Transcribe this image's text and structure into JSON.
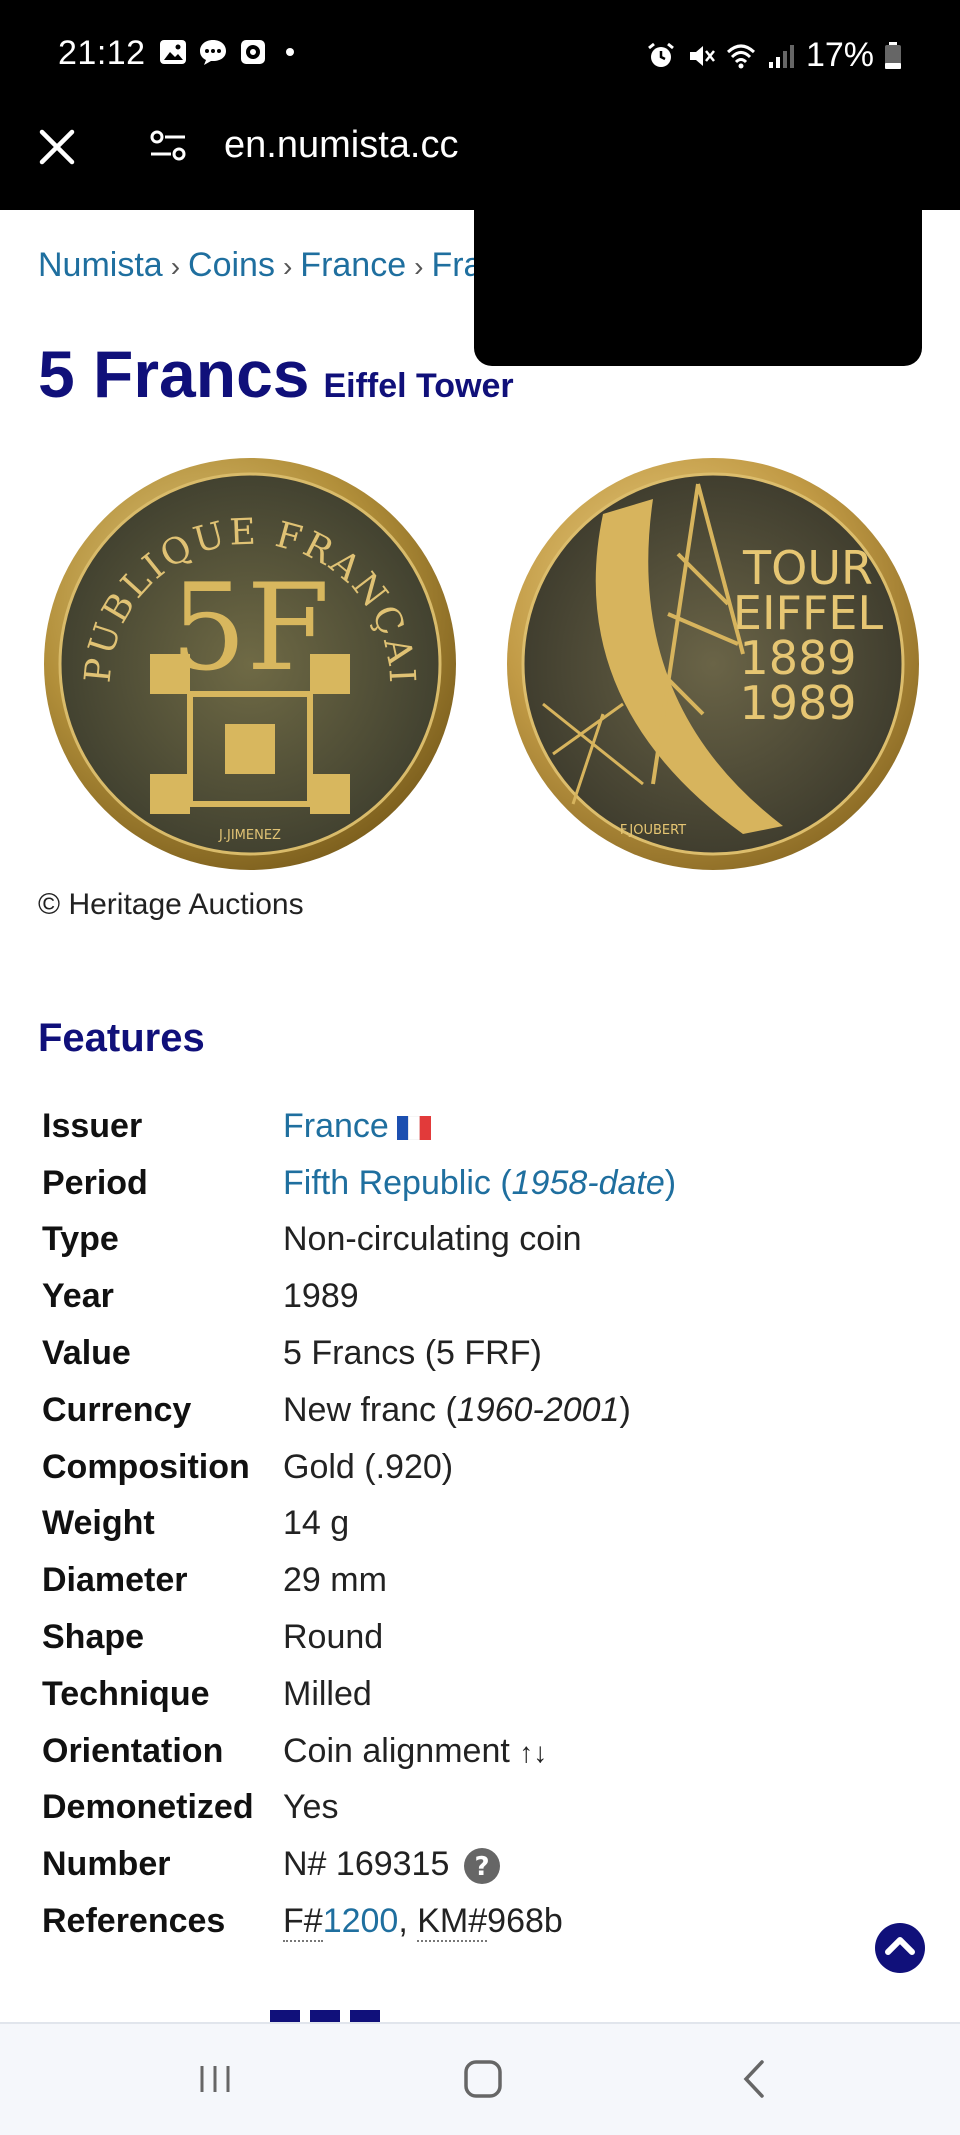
{
  "status_bar": {
    "time": "21:12",
    "battery": "17%",
    "left_icons": [
      "gallery-icon",
      "chat-icon",
      "record-icon"
    ],
    "right_icons": [
      "alarm-icon",
      "mute-icon",
      "wifi-icon",
      "signal-icon",
      "battery-icon"
    ]
  },
  "browser": {
    "url": "en.numista.cc"
  },
  "breadcrumb": {
    "items": [
      "Numista",
      "Coins",
      "France",
      "Fra"
    ],
    "separator": "›"
  },
  "title": {
    "main": "5 Francs",
    "sub": "Eiffel Tower"
  },
  "coin_obverse": {
    "legend": "REPUBLIQUE FRANÇAISE",
    "denomination": "5F",
    "engraver": "J.JIMENEZ"
  },
  "coin_reverse": {
    "lines": [
      "TOUR",
      "EIFFEL",
      "1889",
      "1989"
    ],
    "engraver": "F.JOUBERT"
  },
  "copyright": "© Heritage Auctions",
  "features": {
    "heading": "Features",
    "rows": {
      "issuer": {
        "label": "Issuer",
        "value": "France"
      },
      "period": {
        "label": "Period",
        "value": "Fifth Republic (",
        "years": "1958-date",
        "close": ")"
      },
      "type": {
        "label": "Type",
        "value": "Non-circulating coin"
      },
      "year": {
        "label": "Year",
        "value": "1989"
      },
      "value": {
        "label": "Value",
        "value": "5 Francs (5 FRF)"
      },
      "currency": {
        "label": "Currency",
        "value": "New franc (",
        "years": "1960-2001",
        "close": ")"
      },
      "composition": {
        "label": "Composition",
        "value": "Gold (.920)"
      },
      "weight": {
        "label": "Weight",
        "value": "14 g"
      },
      "diameter": {
        "label": "Diameter",
        "value": "29 mm"
      },
      "shape": {
        "label": "Shape",
        "value": "Round"
      },
      "technique": {
        "label": "Technique",
        "value": "Milled"
      },
      "orientation": {
        "label": "Orientation",
        "value": "Coin alignment ",
        "arrows": "↑↓"
      },
      "demonetized": {
        "label": "Demonetized",
        "value": "Yes"
      },
      "number": {
        "label": "Number",
        "value": "N# 169315"
      },
      "references": {
        "label": "References",
        "f_prefix": "F#",
        "f_number": "1200",
        "sep": ", ",
        "km_prefix": "KM#",
        "km_number": "968b"
      }
    }
  },
  "colors": {
    "title": "#10107a",
    "link": "#1f6f9f",
    "gold": "#c9a24a"
  }
}
